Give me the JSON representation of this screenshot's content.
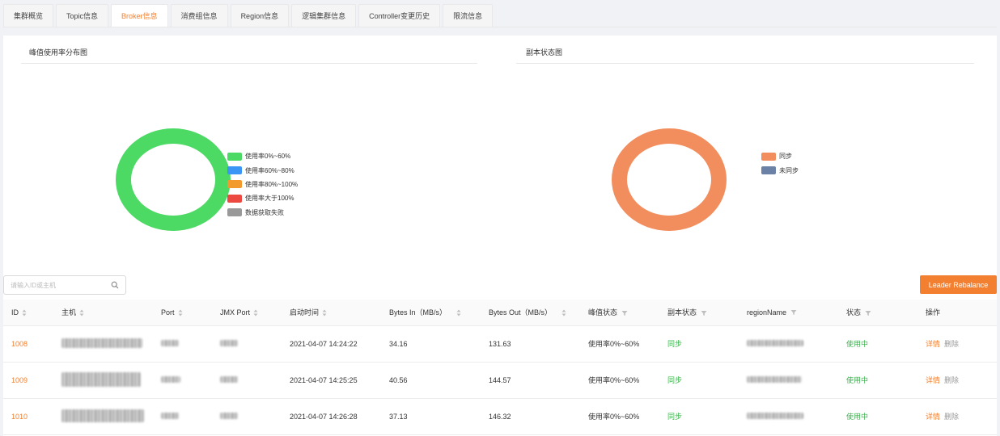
{
  "tabs": [
    {
      "label": "集群概览",
      "active": false
    },
    {
      "label": "Topic信息",
      "active": false
    },
    {
      "label": "Broker信息",
      "active": true
    },
    {
      "label": "消费组信息",
      "active": false
    },
    {
      "label": "Region信息",
      "active": false
    },
    {
      "label": "逻辑集群信息",
      "active": false
    },
    {
      "label": "Controller变更历史",
      "active": false
    },
    {
      "label": "限流信息",
      "active": false
    }
  ],
  "peak_chart": {
    "title": "峰值使用率分布图",
    "legend": [
      {
        "label": "使用率0%~60%",
        "color": "#4cd964"
      },
      {
        "label": "使用率60%~80%",
        "color": "#3a95f5"
      },
      {
        "label": "使用率80%~100%",
        "color": "#f39a2f"
      },
      {
        "label": "使用率大于100%",
        "color": "#ec4a41"
      },
      {
        "label": "数据获取失败",
        "color": "#999999"
      }
    ]
  },
  "replica_chart": {
    "title": "副本状态图",
    "legend": [
      {
        "label": "同步",
        "color": "#f28e5d"
      },
      {
        "label": "未同步",
        "color": "#6b82a6"
      }
    ]
  },
  "chart_data": [
    {
      "type": "pie",
      "title": "峰值使用率分布图",
      "categories": [
        "使用率0%~60%",
        "使用率60%~80%",
        "使用率80%~100%",
        "使用率大于100%",
        "数据获取失败"
      ],
      "values": [
        3,
        0,
        0,
        0,
        0
      ],
      "colors": [
        "#4cd964",
        "#3a95f5",
        "#f39a2f",
        "#ec4a41",
        "#999999"
      ],
      "legend": "right"
    },
    {
      "type": "pie",
      "title": "副本状态图",
      "categories": [
        "同步",
        "未同步"
      ],
      "values": [
        3,
        0
      ],
      "colors": [
        "#f28e5d",
        "#6b82a6"
      ],
      "legend": "right"
    }
  ],
  "search": {
    "placeholder": "请输入ID或主机"
  },
  "rebalance_label": "Leader Rebalance",
  "table": {
    "headers": {
      "id": "ID",
      "host": "主机",
      "port": "Port",
      "jmx_port": "JMX Port",
      "start_time": "启动时间",
      "bytes_in": "Bytes In（MB/s）",
      "bytes_out": "Bytes Out（MB/s）",
      "peak_status": "峰值状态",
      "replica_status": "副本状态",
      "region_name": "regionName",
      "status": "状态",
      "actions": "操作"
    },
    "rows": [
      {
        "id": "1008",
        "start_time": "2021-04-07 14:24:22",
        "bytes_in": "34.16",
        "bytes_out": "131.63",
        "peak_status": "使用率0%~60%",
        "replica_status": "同步",
        "status": "使用中",
        "detail": "详情",
        "delete": "删除"
      },
      {
        "id": "1009",
        "start_time": "2021-04-07 14:25:25",
        "bytes_in": "40.56",
        "bytes_out": "144.57",
        "peak_status": "使用率0%~60%",
        "replica_status": "同步",
        "status": "使用中",
        "detail": "详情",
        "delete": "删除"
      },
      {
        "id": "1010",
        "start_time": "2021-04-07 14:26:28",
        "bytes_in": "37.13",
        "bytes_out": "146.32",
        "peak_status": "使用率0%~60%",
        "replica_status": "同步",
        "status": "使用中",
        "detail": "详情",
        "delete": "删除"
      }
    ]
  }
}
